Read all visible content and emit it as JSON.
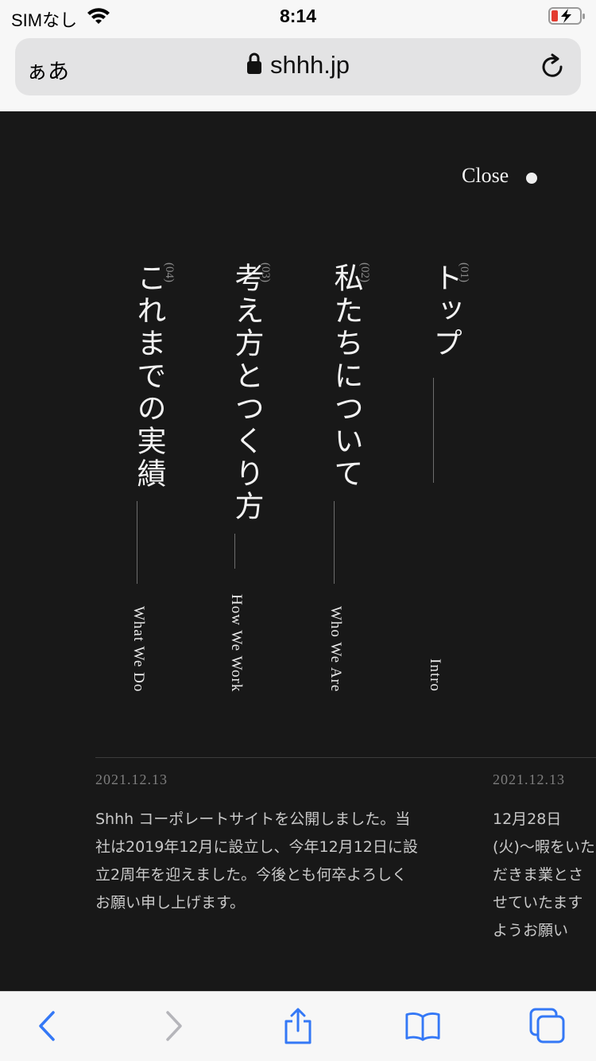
{
  "status_bar": {
    "carrier": "SIMなし",
    "time": "8:14",
    "wifi_icon": "wifi-icon",
    "battery_icon": "battery-charging-icon"
  },
  "address_bar": {
    "reader_label": "ぁあ",
    "url": "shhh.jp",
    "lock_icon": "lock-icon",
    "reload_icon": "reload-icon"
  },
  "site": {
    "close_label": "Close",
    "menu": [
      {
        "number": "(01)",
        "title_jp": "トップ",
        "title_en": "Intro"
      },
      {
        "number": "(02)",
        "title_jp": "私たちについて",
        "title_en": "Who We Are"
      },
      {
        "number": "(03)",
        "title_jp": "考え方とつくり方",
        "title_en": "How We Work"
      },
      {
        "number": "(04)",
        "title_jp": "これまでの実績",
        "title_en": "What We Do"
      }
    ],
    "news": [
      {
        "date": "2021.12.13",
        "text": "Shhh コーポレートサイトを公開しました。当社は2019年12月に設立し、今年12月12日に設立2周年を迎えました。今後とも何卒よろしくお願い申し上げます。"
      },
      {
        "date": "2021.12.13",
        "text": "12月28日(火)〜暇をいただきま業とさせていたますようお願い"
      }
    ]
  },
  "bottom_toolbar": {
    "icons": [
      "back-icon",
      "forward-icon",
      "share-icon",
      "bookmarks-icon",
      "tabs-icon"
    ]
  },
  "colors": {
    "site_background": "#181818",
    "safari_blue": "#3478f6",
    "disabled_gray": "#b5b5ba"
  }
}
